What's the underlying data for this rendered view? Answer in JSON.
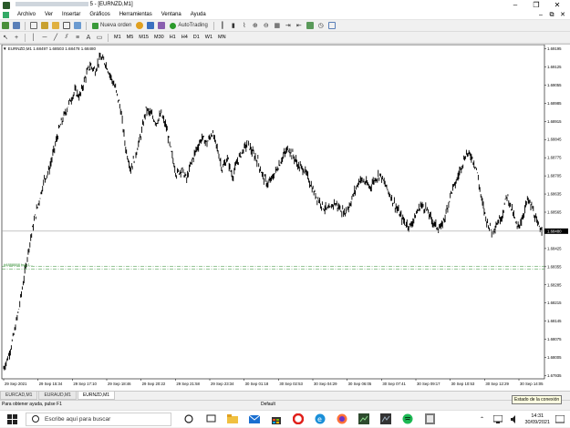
{
  "window": {
    "title_suffix": "5 - [EURNZD,M1]",
    "controls": [
      "–",
      "❐",
      "✕"
    ]
  },
  "menu": {
    "items": [
      "Archivo",
      "Ver",
      "Insertar",
      "Gráficos",
      "Herramientas",
      "Ventana",
      "Ayuda"
    ],
    "mdi_controls": [
      "–",
      "⧉",
      "✕"
    ]
  },
  "toolbar": {
    "new_order_label": "Nueva orden",
    "autotrading_label": "AutoTrading",
    "periods": [
      "M1",
      "M5",
      "M15",
      "M30",
      "H1",
      "H4",
      "D1",
      "W1",
      "MN"
    ]
  },
  "chart": {
    "header": "▼ EURNZD,M1  1.68497 1.68503 1.68478 1.68480",
    "current_price_label": "1.68480",
    "order_label": "#4888888 buy 1...",
    "colors": {
      "bar": "#000000",
      "trade_line": "#2e8b2e",
      "price_line": "#a0a0a0",
      "price_tag_bg": "#000000",
      "price_tag_fg": "#ffffff"
    }
  },
  "chart_data": {
    "type": "line",
    "symbol": "EURNZD",
    "timeframe": "M1",
    "ylim": [
      1.6791,
      1.692
    ],
    "y_ticks": [
      "1.69195",
      "1.69125",
      "1.69055",
      "1.68985",
      "1.68915",
      "1.68845",
      "1.68775",
      "1.68705",
      "1.68635",
      "1.68565",
      "1.68495",
      "1.68425",
      "1.68355",
      "1.68285",
      "1.68215",
      "1.68145",
      "1.68075",
      "1.68005",
      "1.67935"
    ],
    "x_ticks": [
      "29 Sep 2021",
      "29 Sep 15:34",
      "29 Sep 17:10",
      "29 Sep 18:46",
      "29 Sep 20:22",
      "29 Sep 21:58",
      "29 Sep 23:34",
      "30 Sep 01:18",
      "30 Sep 02:53",
      "30 Sep 04:29",
      "30 Sep 06:05",
      "30 Sep 07:41",
      "30 Sep 09:17",
      "30 Sep 10:53",
      "30 Sep 12:29",
      "30 Sep 14:05"
    ],
    "close_series": [
      1.6795,
      1.68,
      1.6808,
      1.6818,
      1.683,
      1.6842,
      1.6852,
      1.686,
      1.6868,
      1.6872,
      1.688,
      1.6888,
      1.6893,
      1.6898,
      1.6902,
      1.69,
      1.6907,
      1.6912,
      1.691,
      1.6915,
      1.6913,
      1.6908,
      1.6903,
      1.6895,
      1.688,
      1.6872,
      1.6878,
      1.6885,
      1.6895,
      1.6893,
      1.689,
      1.6893,
      1.6888,
      1.6878,
      1.687,
      1.6872,
      1.6868,
      1.6875,
      1.688,
      1.6884,
      1.6882,
      1.6886,
      1.688,
      1.6872,
      1.6876,
      1.6869,
      1.6875,
      1.6879,
      1.6882,
      1.6878,
      1.6875,
      1.6869,
      1.6866,
      1.6869,
      1.6873,
      1.6877,
      1.688,
      1.6877,
      1.6873,
      1.6872,
      1.6868,
      1.6863,
      1.686,
      1.6857,
      1.6856,
      1.6859,
      1.6857,
      1.6855,
      1.6858,
      1.6863,
      1.6868,
      1.6867,
      1.6865,
      1.6868,
      1.687,
      1.6866,
      1.6862,
      1.6858,
      1.6854,
      1.6851,
      1.685,
      1.6854,
      1.6858,
      1.6857,
      1.6853,
      1.685,
      1.6849,
      1.6855,
      1.6863,
      1.6867,
      1.6873,
      1.6878,
      1.6877,
      1.6872,
      1.686,
      1.6852,
      1.6848,
      1.6851,
      1.6854,
      1.6862,
      1.6856,
      1.6849,
      1.6853,
      1.686,
      1.6857,
      1.685,
      1.6849
    ],
    "overlays": [
      {
        "name": "order",
        "type": "hline",
        "style": "dash-dot"
      },
      {
        "name": "bid",
        "type": "hline",
        "value": 1.6848
      }
    ],
    "grid": false,
    "legend": "none"
  },
  "tabs": [
    "EURCAD,M1",
    "EURAUD,M1",
    "EURNZD,M1"
  ],
  "active_tab": 2,
  "status": {
    "help_text": "Para obtener ayuda, pulse F1",
    "profile": "Default",
    "tooltip": "Estado de la conexión"
  },
  "taskbar": {
    "search_placeholder": "Escribe aquí para buscar",
    "time": "14:31",
    "date": "30/09/2021"
  }
}
